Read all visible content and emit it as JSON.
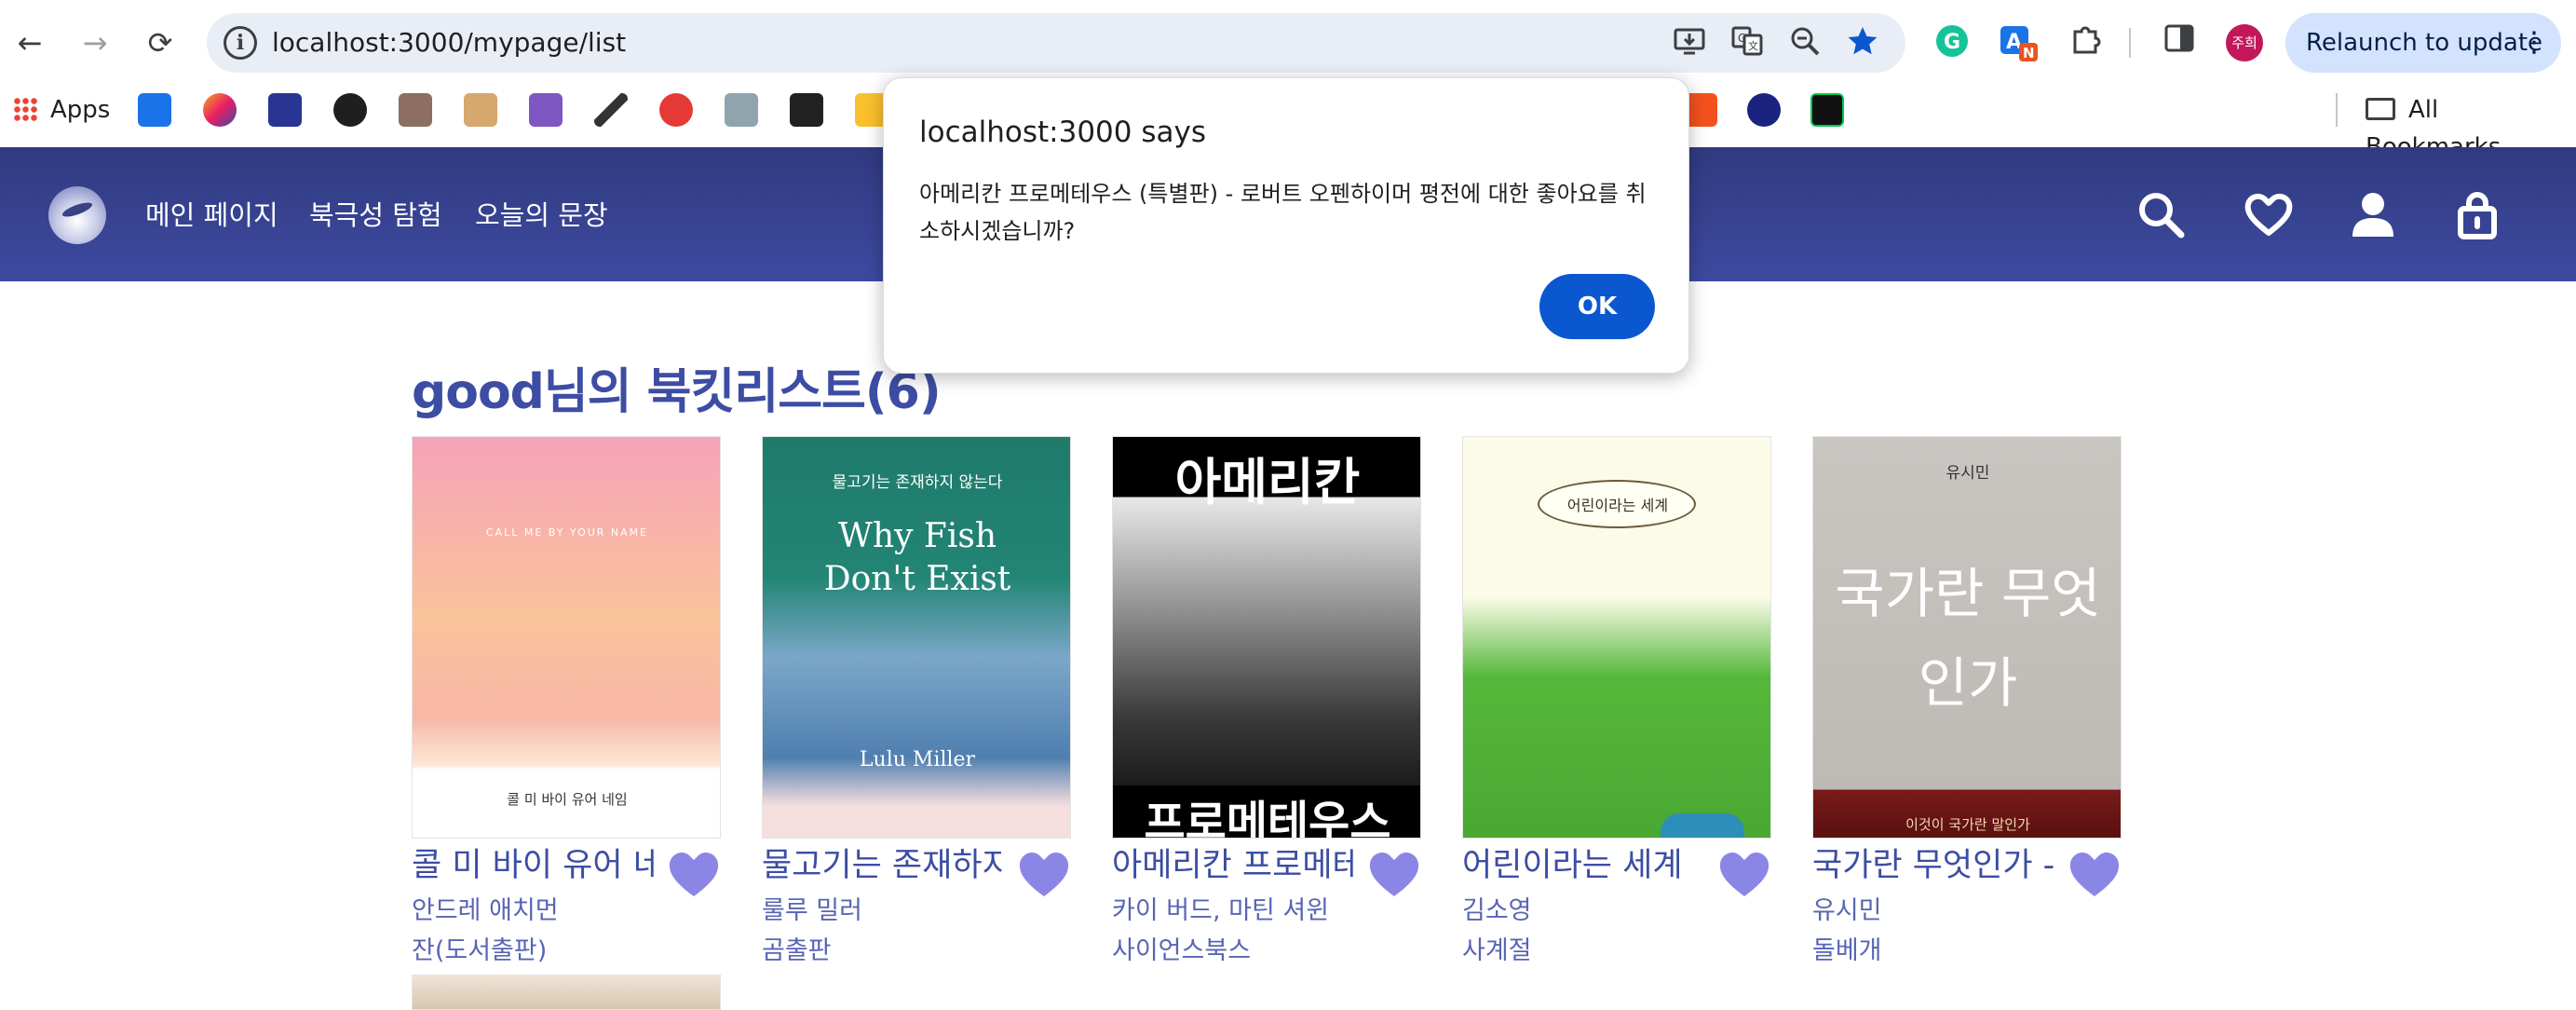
{
  "browser": {
    "url": "localhost:3000/mypage/list",
    "relaunch_label": "Relaunch to update",
    "profile_initials": "주희",
    "bookmarks_apps_label": "Apps",
    "all_bookmarks_label": "All Bookmarks"
  },
  "site": {
    "nav": [
      "메인 페이지",
      "북극성 탐험",
      "오늘의 문장"
    ]
  },
  "dialog": {
    "title": "localhost:3000 says",
    "message": "아메리칸 프로메테우스 (특별판) - 로버트 오펜하이머 평전에 대한 좋아요를 취소하시겠습니까?",
    "ok_label": "OK"
  },
  "page": {
    "list_title": "good님의 북킷리스트(6)",
    "books": [
      {
        "title": "콜 미 바이 유어 네임",
        "author": "안드레 애치먼",
        "publisher": "잔(도서출판)",
        "cover_main": "콜 미 바이 유어 네임",
        "cover_sub": "CALL ME BY YOUR NAME"
      },
      {
        "title": "물고기는 존재하지 않는다",
        "author": "룰루 밀러",
        "publisher": "곰출판",
        "cover_main": "Why Fish Don't Exist",
        "cover_sub": "물고기는 존재하지 않는다",
        "cover_author": "Lulu Miller"
      },
      {
        "title": "아메리칸 프로메테우스",
        "author": "카이 버드, 마틴 셔윈",
        "publisher": "사이언스북스",
        "cover_main": "아메리칸",
        "cover_sub": "프로메테우스"
      },
      {
        "title": "어린이라는 세계",
        "author": "김소영",
        "publisher": "사계절",
        "cover_main": "어린이라는 세계"
      },
      {
        "title": "국가란 무엇인가 - 개정신판",
        "author": "유시민",
        "publisher": "돌베개",
        "cover_main": "국가란 무엇인가",
        "cover_author": "유시민",
        "cover_sub": "이것이 국가란 말인가"
      }
    ]
  },
  "colors": {
    "header_bg": "#3d4aa0",
    "accent": "#3d4da3",
    "heart": "#8b86e6",
    "dialog_button": "#0b57d0"
  }
}
